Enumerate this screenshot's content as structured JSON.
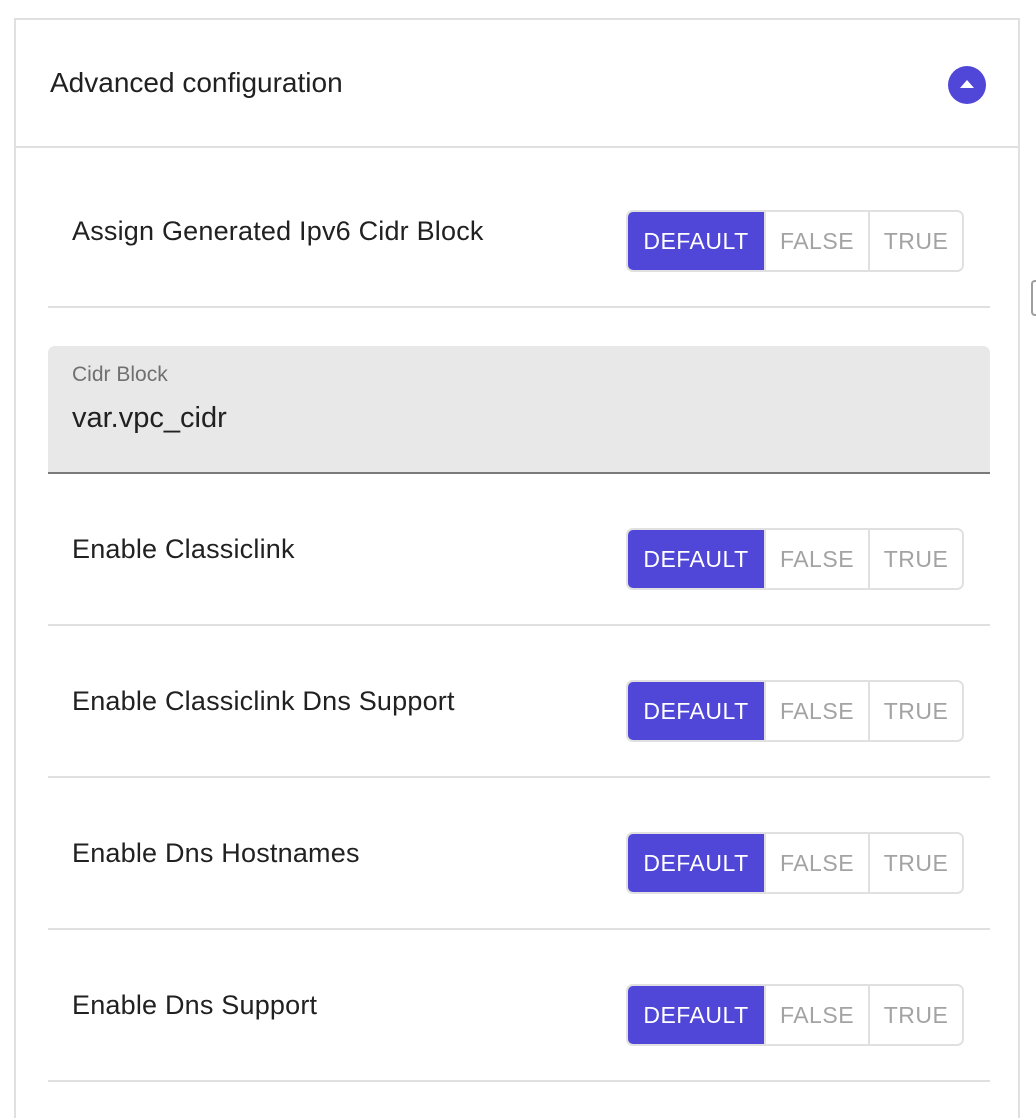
{
  "section": {
    "title": "Advanced configuration",
    "collapse_icon": "chevron-up-icon",
    "accent_color": "#5046d8"
  },
  "toggle_options": [
    "DEFAULT",
    "FALSE",
    "TRUE"
  ],
  "rows": [
    {
      "label": "Assign Generated Ipv6 Cidr Block",
      "selected": "DEFAULT"
    },
    {
      "label": "Enable Classiclink",
      "selected": "DEFAULT"
    },
    {
      "label": "Enable Classiclink Dns Support",
      "selected": "DEFAULT"
    },
    {
      "label": "Enable Dns Hostnames",
      "selected": "DEFAULT"
    },
    {
      "label": "Enable Dns Support",
      "selected": "DEFAULT"
    }
  ],
  "cidr_field": {
    "label": "Cidr Block",
    "value": "var.vpc_cidr"
  }
}
